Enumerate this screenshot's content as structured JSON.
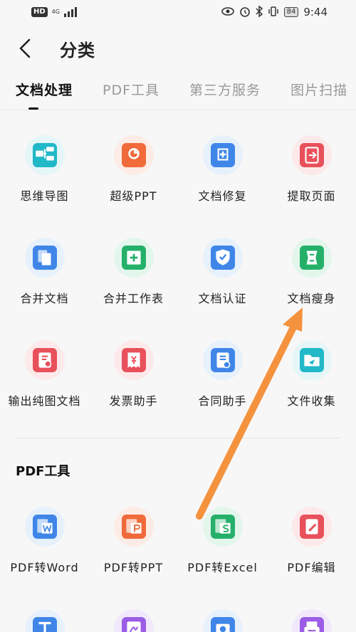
{
  "status_bar": {
    "hd": "HD",
    "network": "4G",
    "battery": "84",
    "time": "9:44"
  },
  "header": {
    "title": "分类"
  },
  "tabs": [
    {
      "label": "文档处理",
      "active": true
    },
    {
      "label": "PDF工具",
      "active": false
    },
    {
      "label": "第三方服务",
      "active": false
    },
    {
      "label": "图片扫描",
      "active": false
    }
  ],
  "doc_tools": [
    {
      "label": "思维导图",
      "icon": "mindmap-icon",
      "bg": "#e5f6f8",
      "color": "#21b8c8"
    },
    {
      "label": "超级PPT",
      "icon": "ppt-icon",
      "bg": "#fdebe5",
      "color": "#f06a3a"
    },
    {
      "label": "文档修复",
      "icon": "repair-icon",
      "bg": "#e7f1fc",
      "color": "#3f86e8"
    },
    {
      "label": "提取页面",
      "icon": "extract-icon",
      "bg": "#fde9ea",
      "color": "#e8505b"
    },
    {
      "label": "合并文档",
      "icon": "merge-doc-icon",
      "bg": "#e7f1fc",
      "color": "#3f86e8"
    },
    {
      "label": "合并工作表",
      "icon": "merge-sheet-icon",
      "bg": "#e3f6ec",
      "color": "#25b06a"
    },
    {
      "label": "文档认证",
      "icon": "certify-icon",
      "bg": "#e7f1fc",
      "color": "#3f86e8"
    },
    {
      "label": "文档瘦身",
      "icon": "slim-icon",
      "bg": "#e3f6ec",
      "color": "#25b06a"
    },
    {
      "label": "输出纯图文档",
      "icon": "image-doc-icon",
      "bg": "#fde9ea",
      "color": "#e8505b"
    },
    {
      "label": "发票助手",
      "icon": "invoice-icon",
      "bg": "#fde9ea",
      "color": "#e8505b"
    },
    {
      "label": "合同助手",
      "icon": "contract-icon",
      "bg": "#e7f1fc",
      "color": "#3f86e8"
    },
    {
      "label": "文件收集",
      "icon": "collect-icon",
      "bg": "#e5f6f8",
      "color": "#21b8c8"
    }
  ],
  "pdf_section": {
    "title": "PDF工具",
    "items": [
      {
        "label": "PDF转Word",
        "icon": "pdf-word-icon",
        "bg": "#e7f1fc",
        "color": "#3f86e8"
      },
      {
        "label": "PDF转PPT",
        "icon": "pdf-ppt-icon",
        "bg": "#fdebe5",
        "color": "#f06a3a"
      },
      {
        "label": "PDF转Excel",
        "icon": "pdf-excel-icon",
        "bg": "#e3f6ec",
        "color": "#25b06a"
      },
      {
        "label": "PDF编辑",
        "icon": "pdf-edit-icon",
        "bg": "#fde9ea",
        "color": "#e8505b"
      }
    ],
    "partial_row": [
      {
        "icon": "text-icon",
        "bg": "#e7f1fc",
        "color": "#3f86e8"
      },
      {
        "icon": "sign-icon",
        "bg": "#f1e9fb",
        "color": "#9b5de5"
      },
      {
        "icon": "ocr-icon",
        "bg": "#e7f1fc",
        "color": "#3f86e8"
      },
      {
        "icon": "print-icon",
        "bg": "#f1e9fb",
        "color": "#9b5de5"
      }
    ]
  },
  "arrow_color": "#f5923e"
}
